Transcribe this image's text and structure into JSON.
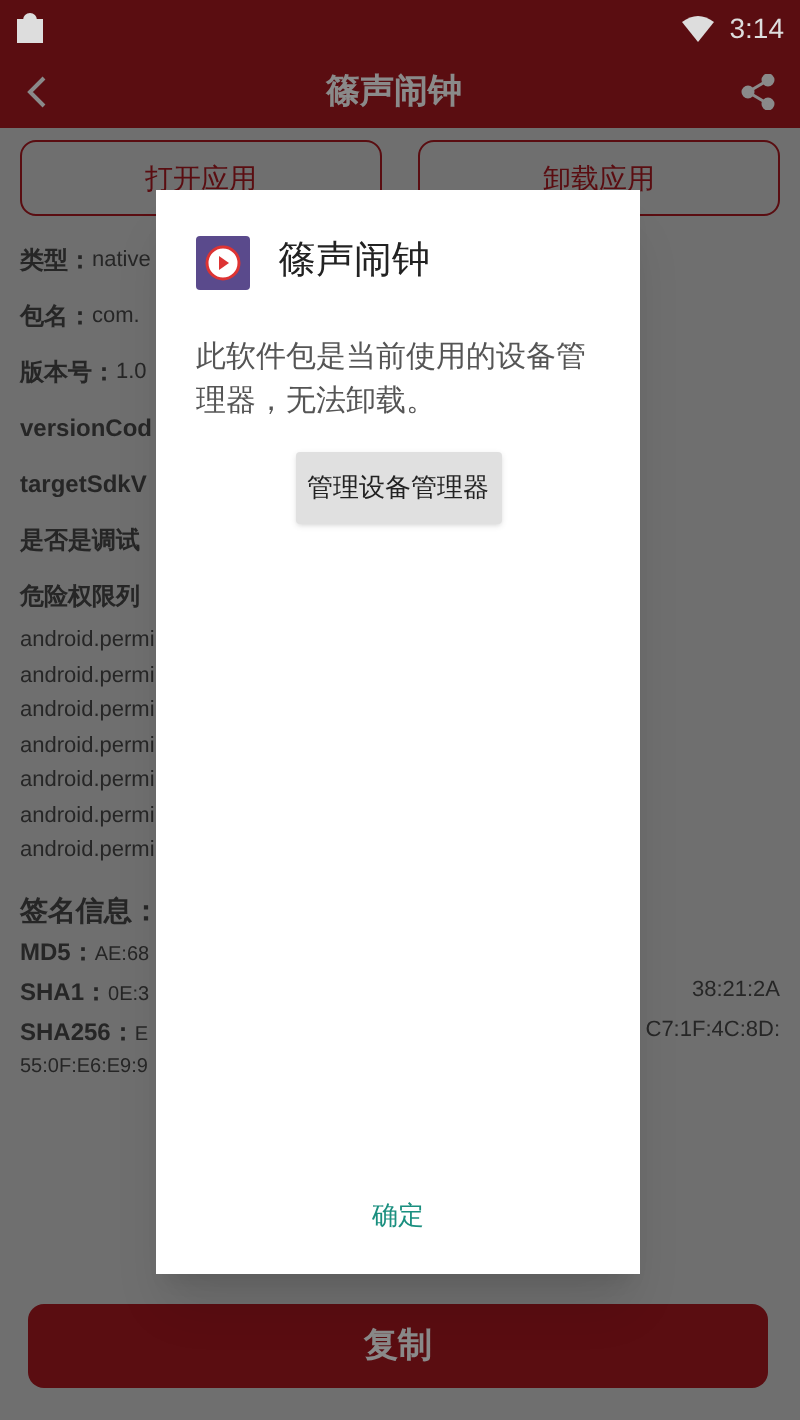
{
  "status_bar": {
    "time": "3:14"
  },
  "header": {
    "title": "篠声闹钟"
  },
  "actions": [
    "打开应用",
    "卸载应用"
  ],
  "info": [
    {
      "label": "类型：",
      "value": "native"
    },
    {
      "label": "包名：",
      "value": "com."
    },
    {
      "label": "版本号：",
      "value": "1.0"
    },
    {
      "label": "versionCod"
    },
    {
      "label": "targetSdkV"
    },
    {
      "label": "是否是调试"
    },
    {
      "label": "危险权限列"
    }
  ],
  "permissions": [
    "android.permi",
    "android.permi",
    "android.permi",
    "android.permi",
    "android.permi",
    "android.permi",
    "android.permi"
  ],
  "signature": {
    "title": "签名信息：",
    "lines": [
      {
        "label": "MD5：",
        "value": "AE:68"
      },
      {
        "label": "SHA1：",
        "value": "0E:3",
        "tail": "38:21:2A"
      },
      {
        "label": "SHA256：",
        "value": "E",
        "tail": "C7:1F:4C:8D:"
      }
    ],
    "extra": "55:0F:E6:E9:9"
  },
  "copy_button": "复制",
  "dialog": {
    "title": "篠声闹钟",
    "message": "此软件包是当前使用的设备管理器，无法卸载。",
    "manage_button": "管理设备管理器",
    "ok_button": "确定"
  }
}
